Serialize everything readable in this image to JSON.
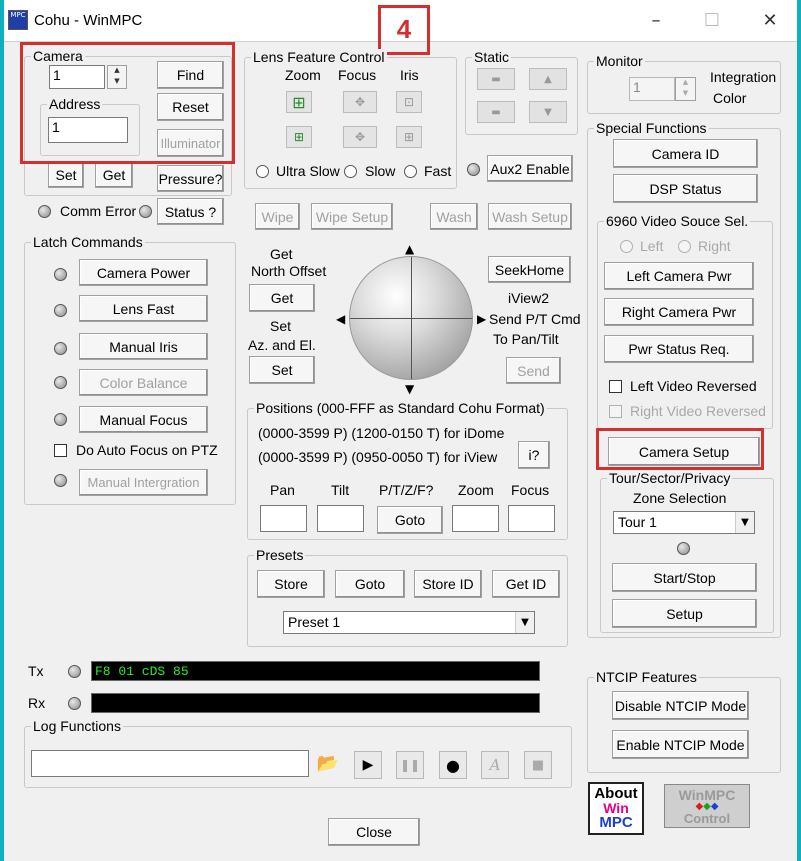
{
  "window": {
    "title": "Cohu - WinMPC",
    "app_icon_text": "MPC"
  },
  "annotation": {
    "step_number": "4"
  },
  "camera": {
    "group_label": "Camera",
    "camera_value": "1",
    "address_label": "Address",
    "address_value": "1",
    "find": "Find",
    "reset": "Reset",
    "illuminator": "Illuminator",
    "set": "Set",
    "get": "Get",
    "pressure": "Pressure?",
    "comm_error": "Comm Error",
    "status": "Status ?"
  },
  "lens": {
    "group_label": "Lens Feature Control",
    "zoom": "Zoom",
    "focus": "Focus",
    "iris": "Iris",
    "ultra_slow": "Ultra Slow",
    "slow": "Slow",
    "fast": "Fast"
  },
  "static": {
    "group_label": "Static"
  },
  "aux2": "Aux2 Enable",
  "wash": {
    "wipe": "Wipe",
    "wipe_setup": "Wipe Setup",
    "wash": "Wash",
    "wash_setup": "Wash Setup"
  },
  "latch": {
    "group_label": "Latch Commands",
    "camera_power": "Camera Power",
    "lens_fast": "Lens Fast",
    "manual_iris": "Manual Iris",
    "color_balance": "Color Balance",
    "manual_focus": "Manual Focus",
    "auto_focus_ptz": "Do Auto Focus on PTZ",
    "manual_integration": "Manual Intergration"
  },
  "offset": {
    "get_north_line1": "Get",
    "get_north_line2": "North Offset",
    "get": "Get",
    "set_az_line1": "Set",
    "set_az_line2": "Az. and El.",
    "set": "Set",
    "seek_home": "SeekHome",
    "iview_line1": "iView2",
    "iview_line2": "Send P/T Cmd",
    "iview_line3": "To Pan/Tilt",
    "send": "Send"
  },
  "positions": {
    "group_label": "Positions (000-FFF as Standard Cohu Format)",
    "idome_line": "(0000-3599  P)  (1200-0150  T) for iDome",
    "iview_line": "(0000-3599  P)  (0950-0050  T) for iView",
    "info": "i?",
    "pan": "Pan",
    "tilt": "Tilt",
    "ptzf": "P/T/Z/F?",
    "zoom": "Zoom",
    "focus": "Focus",
    "goto": "Goto"
  },
  "presets": {
    "group_label": "Presets",
    "store": "Store",
    "goto": "Goto",
    "store_id": "Store ID",
    "get_id": "Get ID",
    "selected": "Preset 1"
  },
  "monitor": {
    "group_label": "Monitor",
    "value": "1",
    "integration": "Integration",
    "color": "Color"
  },
  "special": {
    "group_label": "Special Functions",
    "camera_id": "Camera ID",
    "dsp_status": "DSP Status",
    "video_source_label": "6960 Video Souce Sel.",
    "left": "Left",
    "right": "Right",
    "left_camera_pwr": "Left Camera Pwr",
    "right_camera_pwr": "Right Camera Pwr",
    "pwr_status": "Pwr Status Req.",
    "left_video_reversed": "Left Video Reversed",
    "right_video_reversed": "Right Video Reversed",
    "camera_setup": "Camera Setup"
  },
  "tour": {
    "group_label": "Tour/Sector/Privacy",
    "zone_selection": "Zone Selection",
    "selected": "Tour 1",
    "start_stop": "Start/Stop",
    "setup": "Setup"
  },
  "comm": {
    "tx_label": "Tx",
    "tx_value": "F8 01 cDS 85",
    "rx_label": "Rx",
    "rx_value": ""
  },
  "log": {
    "group_label": "Log Functions",
    "value": ""
  },
  "ntcip": {
    "group_label": "NTCIP Features",
    "disable": "Disable NTCIP Mode",
    "enable": "Enable NTCIP Mode"
  },
  "about": {
    "line1": "About",
    "line2": "Win",
    "line3": "MPC"
  },
  "winmpc_control": {
    "line1": "WinMPC",
    "line2": "Control"
  },
  "close": "Close",
  "colors": {
    "titlebar_accent": "#0fb0bd",
    "highlight": "#d32f2f",
    "terminal_text": "#2ee82e"
  }
}
